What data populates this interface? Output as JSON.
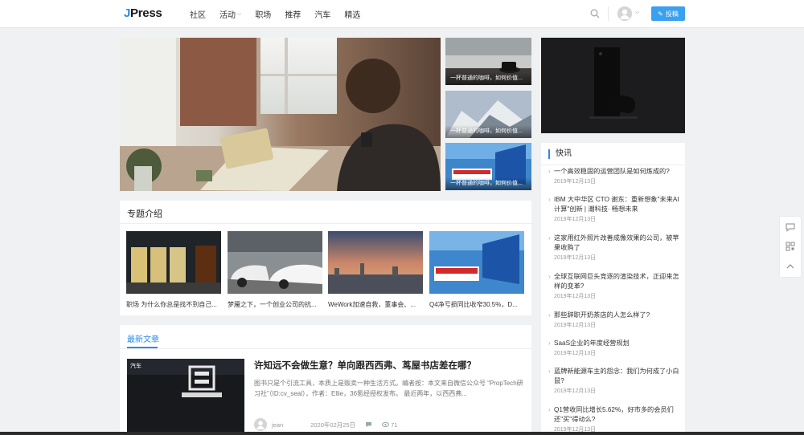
{
  "header": {
    "logo_j": "J",
    "logo_rest": "Press",
    "nav": [
      {
        "label": "社区"
      },
      {
        "label": "活动",
        "has_caret": true
      },
      {
        "label": "职场"
      },
      {
        "label": "推荐"
      },
      {
        "label": "汽车"
      },
      {
        "label": "精选"
      }
    ],
    "post_label": "投稿"
  },
  "side_thumbs": [
    {
      "caption": "一杯普通的咖啡，如何价值..."
    },
    {
      "caption": "一杯普通的咖啡，如何价值..."
    },
    {
      "caption": "一杯普通的咖啡，如何价值..."
    }
  ],
  "topics": {
    "title": "专题介绍",
    "items": [
      {
        "label": "职场 为什么你总是找不到自己..."
      },
      {
        "label": "梦魇之下，一个创业公司的抗..."
      },
      {
        "label": "WeWork加速自救，董事会、..."
      },
      {
        "label": "Q4净亏损同比收窄30.5%，D..."
      }
    ]
  },
  "latest": {
    "tab": "最新文章",
    "article": {
      "tag": "汽车",
      "title": "许知远不会做生意？单向跟西西弗、茑屋书店差在哪？",
      "excerpt": "图书只是个引流工具，本质上是贩卖一种生活方式。编者按：本文来自微信公众号 “PropTech研习社”（ID:cv_seal），作者：Ellie，36氪经授权发布。 最近两年，以西西弗...",
      "author": "jean",
      "date": "2020年02月25日",
      "views": "71"
    }
  },
  "news": {
    "title": "快讯",
    "items": [
      {
        "title": "一个高效稳固的运营团队是如何炼成的?",
        "date": "2019年12月13日"
      },
      {
        "title": "IBM 大中华区 CTO 谢东：重新想象\"未来AI计算\"创新 | 潮科技· 畅想未来",
        "date": "2019年12月13日"
      },
      {
        "title": "这家用红外照片改善成像效果的公司，被苹果收购了",
        "date": "2019年12月13日"
      },
      {
        "title": "全球互联网巨头竞逐的渲染技术，正迎来怎样的变革?",
        "date": "2019年12月13日"
      },
      {
        "title": "那些辞职开奶茶店的人怎么样了?",
        "date": "2019年12月13日"
      },
      {
        "title": "SaaS企业的年度经营规划",
        "date": "2019年12月13日"
      },
      {
        "title": "蓝牌新能源车主的怨念：我们为何成了小白鼠?",
        "date": "2019年12月13日"
      },
      {
        "title": "Q1营收同比增长5.62%，好市多的会员们还\"买\"得动么?",
        "date": "2019年12月13日"
      }
    ]
  },
  "colors": {
    "accent": "#2e8ae6",
    "post_button": "#3aa0f0",
    "page_bg": "#f0f1f3"
  }
}
